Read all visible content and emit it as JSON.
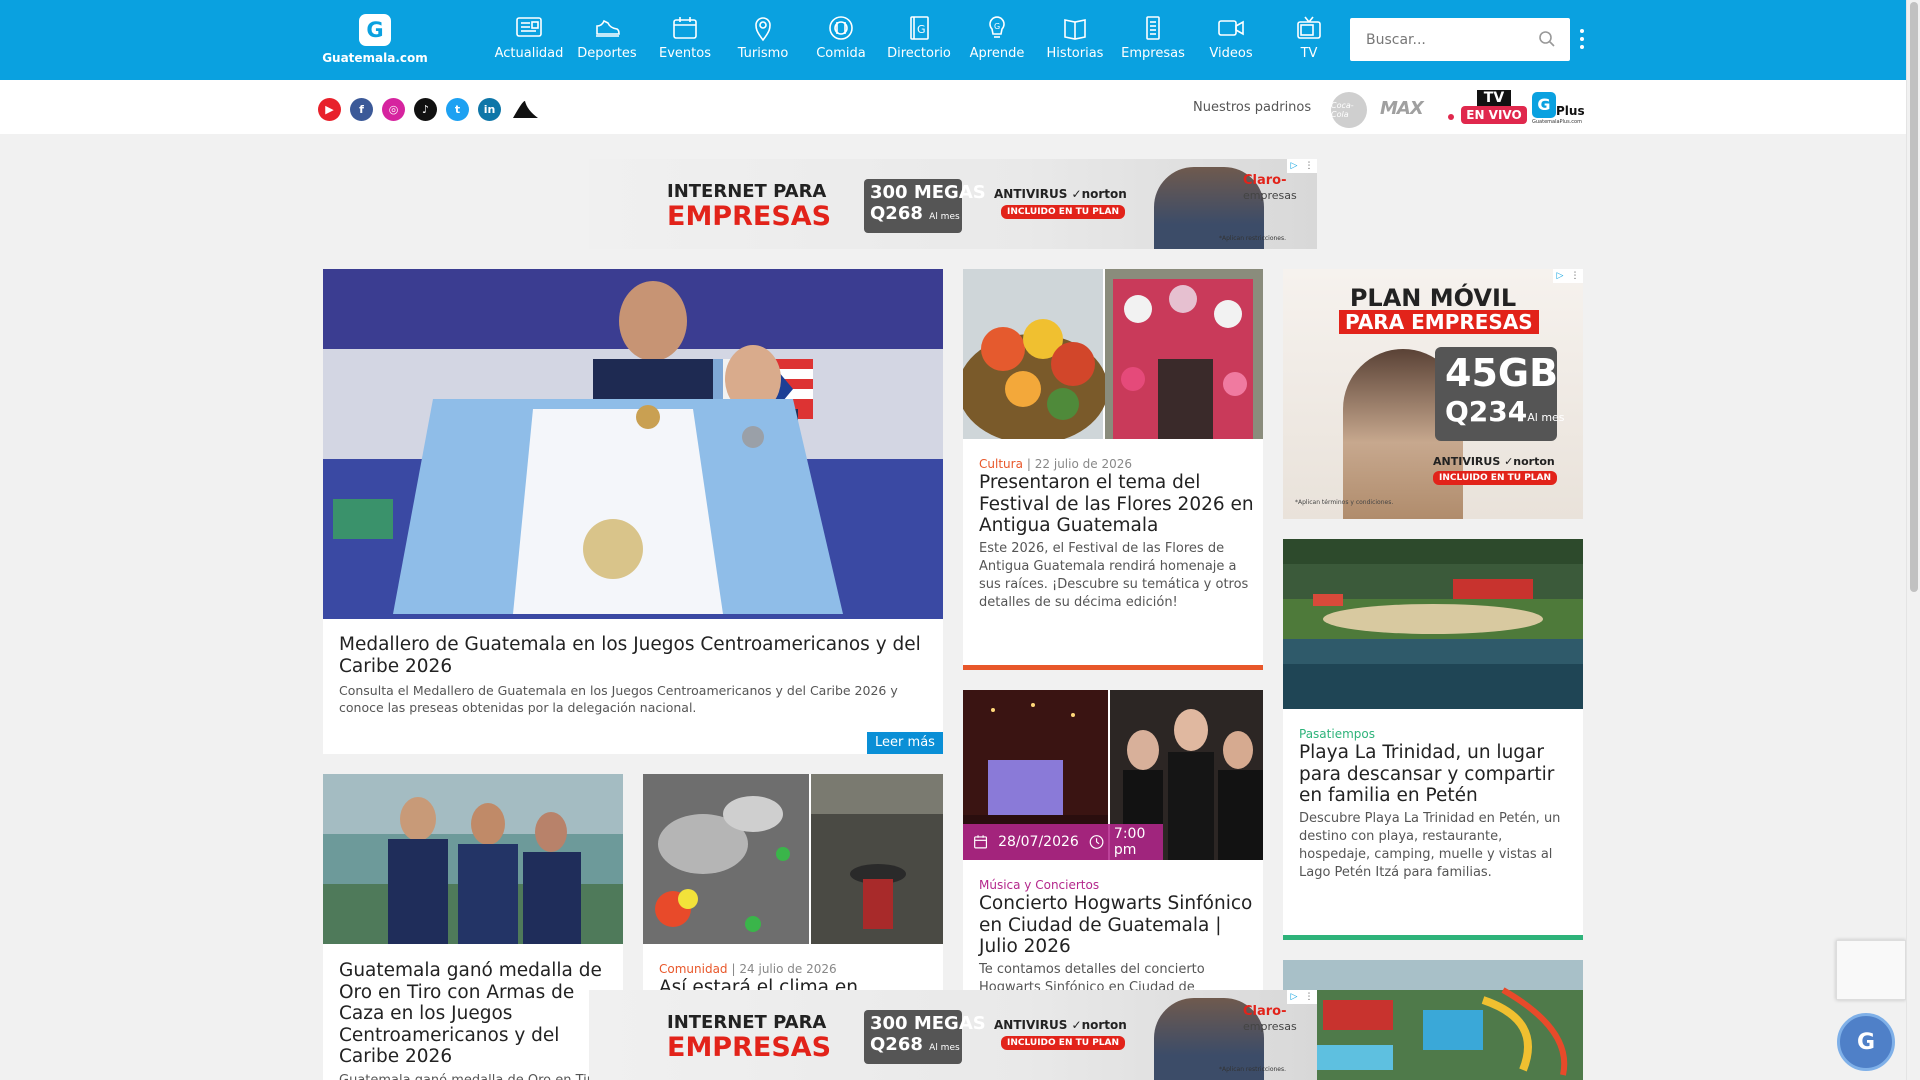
{
  "header": {
    "logo_text": "Guatemala.com",
    "logo_letter": "G",
    "nav": [
      {
        "label": "Actualidad"
      },
      {
        "label": "Deportes"
      },
      {
        "label": "Eventos"
      },
      {
        "label": "Turismo"
      },
      {
        "label": "Comida"
      },
      {
        "label": "Directorio"
      },
      {
        "label": "Aprende"
      },
      {
        "label": "Historias"
      },
      {
        "label": "Empresas"
      },
      {
        "label": "Videos"
      },
      {
        "label": "TV"
      }
    ],
    "search_placeholder": "Buscar..."
  },
  "subbar": {
    "padrinos_label": "Nuestros padrinos",
    "coca_text": "Coca-Cola",
    "max_text": "MAX",
    "tv_text": "TV",
    "envivo_text": "EN VIVO",
    "gplus_letter": "G",
    "gplus_text": "Plus",
    "gplus_small": "GuatemalaPlus.com"
  },
  "ad_banner": {
    "line1": "INTERNET PARA",
    "line2": "EMPRESAS",
    "megas": "300 MEGAS",
    "price": "Q268",
    "price_unit": "Al mes",
    "antivirus": "ANTIVIRUS ✓norton",
    "incluido": "INCLUIDO EN TU PLAN",
    "brand": "Claro-",
    "brand2": "empresas",
    "fine": "*Aplican restricciones."
  },
  "ad_side": {
    "line1": "PLAN MÓVIL",
    "line2": "PARA EMPRESAS",
    "gb": "45GB",
    "price": "Q234",
    "price_unit": "Al mes",
    "antivirus": "ANTIVIRUS ✓norton",
    "incluido": "INCLUIDO EN TU PLAN",
    "fine": "*Aplican términos y condiciones."
  },
  "hero": {
    "title": "Medallero de Guatemala en los Juegos Centroamericanos y del Caribe 2026",
    "desc": "Consulta el Medallero de Guatemala en los Juegos Centroamericanos y del Caribe 2026 y conoce las preseas obtenidas por la delegación nacional.",
    "cta": "Leer más"
  },
  "card_flores": {
    "category": "Cultura",
    "date": "22 julio de 2026",
    "title": "Presentaron el tema del Festival de las Flores 2026 en Antigua Guatemala",
    "desc": "Este 2026, el Festival de las Flores de Antigua Guatemala rendirá homenaje a sus raíces. ¡Descubre su temática y otros detalles de su décima edición!",
    "accent": "#e8572a"
  },
  "card_trinidad": {
    "category": "Pasatiempos",
    "title": "Playa La Trinidad, un lugar para descansar y compartir en familia en Petén",
    "desc": "Descubre Playa La Trinidad en Petén, un destino con playa, restaurante, hospedaje, camping, muelle y vistas al Lago Petén Itzá para familias.",
    "accent": "#2eb37a"
  },
  "card_tiro": {
    "title": "Guatemala ganó medalla de Oro en Tiro con Armas de Caza en los Juegos Centroamericanos y del Caribe 2026",
    "desc": "Guatemala ganó medalla de Oro en Tiro c"
  },
  "card_clima": {
    "category": "Comunidad",
    "date": "24 julio de 2026",
    "title": "Así estará el clima en"
  },
  "card_hogwarts": {
    "date": "28/07/2026",
    "time": "7:00 pm",
    "category": "Música y Conciertos",
    "title": "Concierto Hogwarts Sinfónico en Ciudad de Guatemala | Julio 2026",
    "desc": "Te contamos detalles del concierto Hogwarts Sinfónico en Ciudad de"
  },
  "colors": {
    "brand_blue": "#0aa1e0",
    "cultura": "#e8572a",
    "pasatiempos": "#2eb37a",
    "comunidad": "#e8572a",
    "musica": "#b4288c"
  },
  "float_button_letter": "G"
}
